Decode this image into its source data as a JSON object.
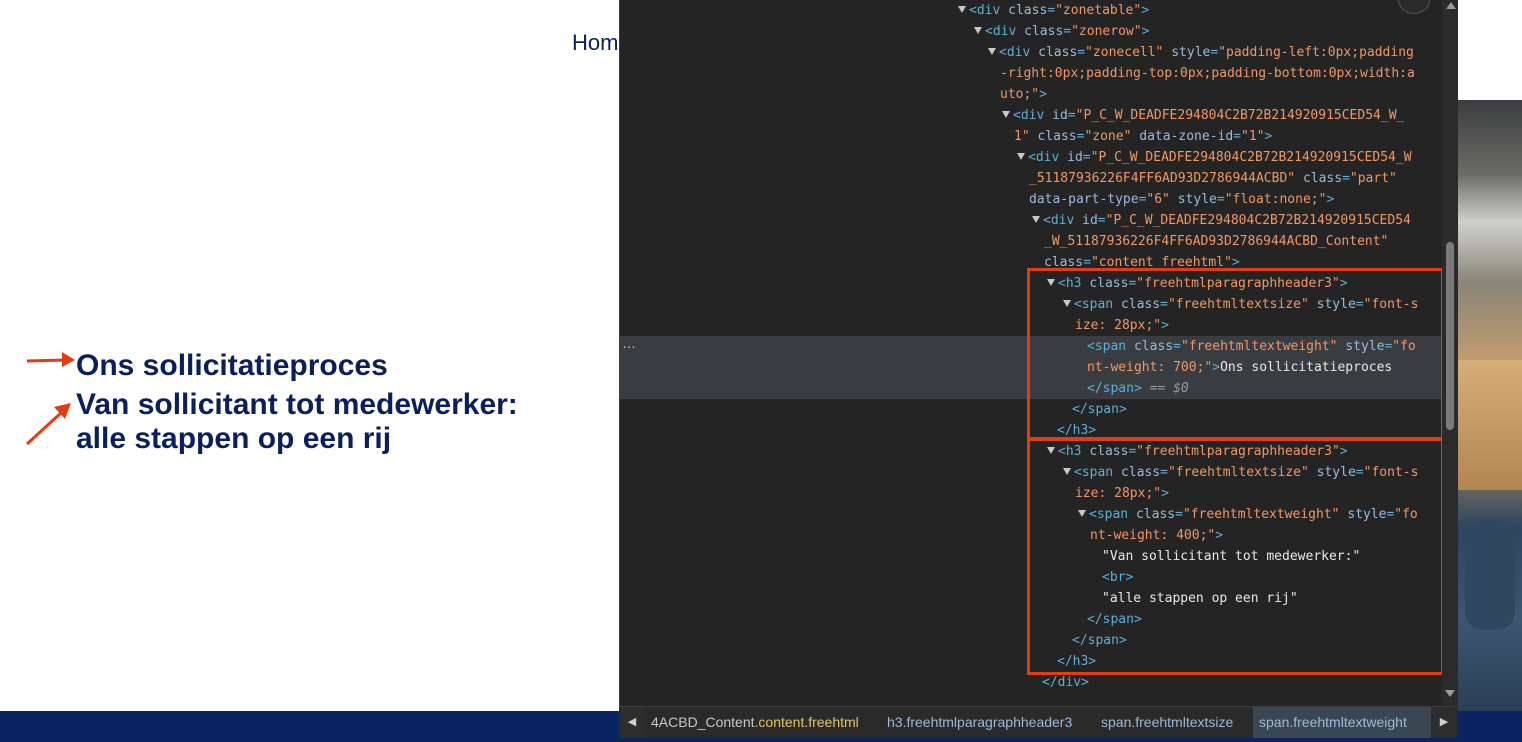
{
  "site": {
    "nav_home": "Home",
    "heading": "Ons sollicitatieproces",
    "subheading_line1": "Van sollicitant tot medewerker:",
    "subheading_line2": "alle stappen op een rij"
  },
  "devtools": {
    "lines": [
      {
        "indent": 338,
        "arrow": true,
        "segs": [
          [
            "tg",
            "<div "
          ],
          [
            "an",
            "class"
          ],
          [
            "tg",
            "="
          ],
          [
            "av",
            "\"zonetable\""
          ],
          [
            "tg",
            ">"
          ]
        ]
      },
      {
        "indent": 354,
        "arrow": true,
        "segs": [
          [
            "tg",
            "<div "
          ],
          [
            "an",
            "class"
          ],
          [
            "tg",
            "="
          ],
          [
            "av",
            "\"zonerow\""
          ],
          [
            "tg",
            ">"
          ]
        ]
      },
      {
        "indent": 368,
        "arrow": true,
        "segs": [
          [
            "tg",
            "<div "
          ],
          [
            "an",
            "class"
          ],
          [
            "tg",
            "="
          ],
          [
            "av",
            "\"zonecell\""
          ],
          [
            "tg",
            " "
          ],
          [
            "an",
            "style"
          ],
          [
            "tg",
            "="
          ],
          [
            "av",
            "\"padding-left:0px;padding"
          ]
        ]
      },
      {
        "indent": 380,
        "arrow": false,
        "segs": [
          [
            "av",
            "-right:0px;padding-top:0px;padding-bottom:0px;width:a"
          ]
        ]
      },
      {
        "indent": 380,
        "arrow": false,
        "segs": [
          [
            "av",
            "uto;\""
          ],
          [
            "tg",
            ">"
          ]
        ]
      },
      {
        "indent": 382,
        "arrow": true,
        "segs": [
          [
            "tg",
            "<div "
          ],
          [
            "an",
            "id"
          ],
          [
            "tg",
            "="
          ],
          [
            "av",
            "\"P_C_W_DEADFE294804C2B72B214920915CED54_W_"
          ]
        ]
      },
      {
        "indent": 394,
        "arrow": false,
        "segs": [
          [
            "av",
            "1\""
          ],
          [
            "tg",
            " "
          ],
          [
            "an",
            "class"
          ],
          [
            "tg",
            "="
          ],
          [
            "av",
            "\"zone\""
          ],
          [
            "tg",
            " "
          ],
          [
            "an",
            "data-zone-id"
          ],
          [
            "tg",
            "="
          ],
          [
            "av",
            "\"1\""
          ],
          [
            "tg",
            ">"
          ]
        ]
      },
      {
        "indent": 397,
        "arrow": true,
        "segs": [
          [
            "tg",
            "<div "
          ],
          [
            "an",
            "id"
          ],
          [
            "tg",
            "="
          ],
          [
            "av",
            "\"P_C_W_DEADFE294804C2B72B214920915CED54_W"
          ]
        ]
      },
      {
        "indent": 409,
        "arrow": false,
        "segs": [
          [
            "av",
            "_51187936226F4FF6AD93D2786944ACBD\""
          ],
          [
            "tg",
            " "
          ],
          [
            "an",
            "class"
          ],
          [
            "tg",
            "="
          ],
          [
            "av",
            "\"part\""
          ]
        ]
      },
      {
        "indent": 409,
        "arrow": false,
        "segs": [
          [
            "an",
            "data-part-type"
          ],
          [
            "tg",
            "="
          ],
          [
            "av",
            "\"6\""
          ],
          [
            "tg",
            " "
          ],
          [
            "an",
            "style"
          ],
          [
            "tg",
            "="
          ],
          [
            "av",
            "\"float:none;\""
          ],
          [
            "tg",
            ">"
          ]
        ]
      },
      {
        "indent": 412,
        "arrow": true,
        "segs": [
          [
            "tg",
            "<div "
          ],
          [
            "an",
            "id"
          ],
          [
            "tg",
            "="
          ],
          [
            "av",
            "\"P_C_W_DEADFE294804C2B72B214920915CED54"
          ]
        ]
      },
      {
        "indent": 424,
        "arrow": false,
        "segs": [
          [
            "av",
            "_W_51187936226F4FF6AD93D2786944ACBD_Content\""
          ]
        ]
      },
      {
        "indent": 424,
        "arrow": false,
        "segs": [
          [
            "an",
            "class"
          ],
          [
            "tg",
            "="
          ],
          [
            "av",
            "\"content freehtml\""
          ],
          [
            "tg",
            ">"
          ]
        ]
      },
      {
        "indent": 427,
        "arrow": true,
        "segs": [
          [
            "tg",
            "<h3 "
          ],
          [
            "an",
            "class"
          ],
          [
            "tg",
            "="
          ],
          [
            "av",
            "\"freehtmlparagraphheader3\""
          ],
          [
            "tg",
            ">"
          ]
        ]
      },
      {
        "indent": 443,
        "arrow": true,
        "segs": [
          [
            "tg",
            "<span "
          ],
          [
            "an",
            "class"
          ],
          [
            "tg",
            "="
          ],
          [
            "av",
            "\"freehtmltextsize\""
          ],
          [
            "tg",
            " "
          ],
          [
            "an",
            "style"
          ],
          [
            "tg",
            "="
          ],
          [
            "av",
            "\"font-s"
          ]
        ]
      },
      {
        "indent": 455,
        "arrow": false,
        "segs": [
          [
            "av",
            "ize: 28px;\""
          ],
          [
            "tg",
            ">"
          ]
        ]
      },
      {
        "indent": 467,
        "arrow": false,
        "selected": true,
        "segs": [
          [
            "tg",
            "<span "
          ],
          [
            "an",
            "class"
          ],
          [
            "tg",
            "="
          ],
          [
            "av",
            "\"freehtmltextweight\""
          ],
          [
            "tg",
            " "
          ],
          [
            "an",
            "style"
          ],
          [
            "tg",
            "="
          ],
          [
            "av",
            "\"fo"
          ]
        ]
      },
      {
        "indent": 467,
        "arrow": false,
        "selected": true,
        "segs": [
          [
            "av",
            "nt-weight: 700;\""
          ],
          [
            "tg",
            ">"
          ],
          [
            "tx",
            "Ons sollicitatieproces"
          ]
        ]
      },
      {
        "indent": 467,
        "arrow": false,
        "selected": true,
        "segs": [
          [
            "tg",
            "</span>"
          ],
          [
            "dim",
            " == $0"
          ]
        ]
      },
      {
        "indent": 452,
        "arrow": false,
        "segs": [
          [
            "tg",
            "</span>"
          ]
        ]
      },
      {
        "indent": 437,
        "arrow": false,
        "segs": [
          [
            "tg",
            "</h3>"
          ]
        ]
      },
      {
        "indent": 427,
        "arrow": true,
        "segs": [
          [
            "tg",
            "<h3 "
          ],
          [
            "an",
            "class"
          ],
          [
            "tg",
            "="
          ],
          [
            "av",
            "\"freehtmlparagraphheader3\""
          ],
          [
            "tg",
            ">"
          ]
        ]
      },
      {
        "indent": 443,
        "arrow": true,
        "segs": [
          [
            "tg",
            "<span "
          ],
          [
            "an",
            "class"
          ],
          [
            "tg",
            "="
          ],
          [
            "av",
            "\"freehtmltextsize\""
          ],
          [
            "tg",
            " "
          ],
          [
            "an",
            "style"
          ],
          [
            "tg",
            "="
          ],
          [
            "av",
            "\"font-s"
          ]
        ]
      },
      {
        "indent": 455,
        "arrow": false,
        "segs": [
          [
            "av",
            "ize: 28px;\""
          ],
          [
            "tg",
            ">"
          ]
        ]
      },
      {
        "indent": 458,
        "arrow": true,
        "segs": [
          [
            "tg",
            "<span "
          ],
          [
            "an",
            "class"
          ],
          [
            "tg",
            "="
          ],
          [
            "av",
            "\"freehtmltextweight\""
          ],
          [
            "tg",
            " "
          ],
          [
            "an",
            "style"
          ],
          [
            "tg",
            "="
          ],
          [
            "av",
            "\"fo"
          ]
        ]
      },
      {
        "indent": 470,
        "arrow": false,
        "segs": [
          [
            "av",
            "nt-weight: 400;\""
          ],
          [
            "tg",
            ">"
          ]
        ]
      },
      {
        "indent": 482,
        "arrow": false,
        "segs": [
          [
            "tx",
            "\"Van sollicitant tot medewerker:\""
          ]
        ]
      },
      {
        "indent": 482,
        "arrow": false,
        "segs": [
          [
            "tg",
            "<br>"
          ]
        ]
      },
      {
        "indent": 482,
        "arrow": false,
        "segs": [
          [
            "tx",
            "\"alle stappen op een rij\""
          ]
        ]
      },
      {
        "indent": 467,
        "arrow": false,
        "segs": [
          [
            "tg",
            "</span>"
          ]
        ]
      },
      {
        "indent": 452,
        "arrow": false,
        "segs": [
          [
            "tg",
            "</span>"
          ]
        ]
      },
      {
        "indent": 437,
        "arrow": false,
        "segs": [
          [
            "tg",
            "</h3>"
          ]
        ]
      },
      {
        "indent": 422,
        "arrow": false,
        "segs": [
          [
            "tg",
            "</div>"
          ]
        ]
      }
    ],
    "ellipsis": "…"
  },
  "breadcrumbs": {
    "items": [
      {
        "pre": "4ACBD_Content",
        "cls": ".content.freehtml"
      },
      {
        "pre": "h3",
        "cls": ".freehtmlparagraphheader3"
      },
      {
        "pre": "span",
        "cls": ".freehtmltextsize"
      },
      {
        "pre": "span",
        "cls": ".freehtmltextweight",
        "active": true
      }
    ]
  },
  "colors": {
    "brand_navy": "#0b1f5c",
    "annotation_red": "#e23d12"
  }
}
